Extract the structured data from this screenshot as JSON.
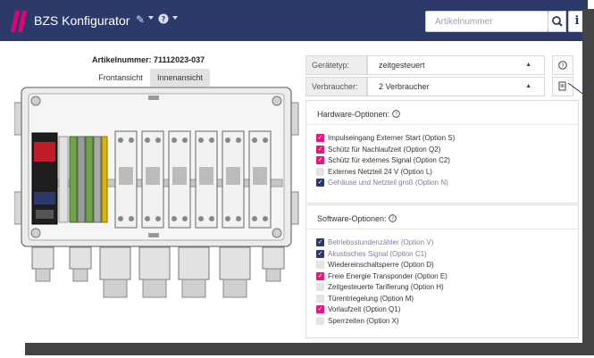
{
  "colors": {
    "navbar": "#2c3a6a",
    "logo": "#e2007a",
    "checked_pink": "#e0197d",
    "checked_blue": "#2c3a6a",
    "disabled_text": "#7b7f9c",
    "enabled_text": "#333333"
  },
  "header": {
    "app_title": "BZS Konfigurator",
    "edit_icon": "edit-icon",
    "help_icon": "help-circle-icon",
    "search_placeholder": "Artikelnummer",
    "search_icon": "search-icon",
    "info_icon": "info-icon",
    "info_label": "i"
  },
  "article": {
    "label": "Artikelnummer:",
    "number": "71112023-037"
  },
  "tabs": [
    {
      "label": "Frontansicht",
      "active": false
    },
    {
      "label": "Innenansicht",
      "active": true
    }
  ],
  "settings": [
    {
      "label": "Gerätetyp:",
      "value": "zeitgesteuert",
      "help_icon": "help-circle-icon"
    },
    {
      "label": "Verbraucher:",
      "value": "2 Verbraucher",
      "help_icon": "document-icon"
    }
  ],
  "hardware": {
    "title": "Hardware-Optionen:",
    "options": [
      {
        "label": "Impulseingang Externer Start (Option S)",
        "state": "checked-pink",
        "enabled": true
      },
      {
        "label": "Schütz für Nachlaufzeit (Option Q2)",
        "state": "checked-pink",
        "enabled": true
      },
      {
        "label": "Schütz für externes Signal (Option C2)",
        "state": "checked-pink",
        "enabled": true
      },
      {
        "label": "Externes Netzteil 24 V (Option L)",
        "state": "unchecked",
        "enabled": true
      },
      {
        "label": "Gehäuse und Netzteil groß (Option N)",
        "state": "checked-blue",
        "enabled": false
      }
    ]
  },
  "software": {
    "title": "Software-Optionen:",
    "options": [
      {
        "label": "Betriebsstundenzähler (Option V)",
        "state": "checked-blue",
        "enabled": false
      },
      {
        "label": "Akustisches Signal (Option C1)",
        "state": "checked-blue",
        "enabled": false
      },
      {
        "label": "Wiedereinschaltsperre (Option D)",
        "state": "unchecked",
        "enabled": true
      },
      {
        "label": "Freie Energie Transponder (Option E)",
        "state": "checked-pink",
        "enabled": true
      },
      {
        "label": "Zeitgesteuerte Tarifierung (Option H)",
        "state": "unchecked",
        "enabled": true
      },
      {
        "label": "Türentriegelung (Option M)",
        "state": "unchecked",
        "enabled": true
      },
      {
        "label": "Vorlaufzeit (Option Q1)",
        "state": "checked-pink",
        "enabled": true
      },
      {
        "label": "Sperrzeiten (Option X)",
        "state": "unchecked",
        "enabled": true
      }
    ]
  }
}
